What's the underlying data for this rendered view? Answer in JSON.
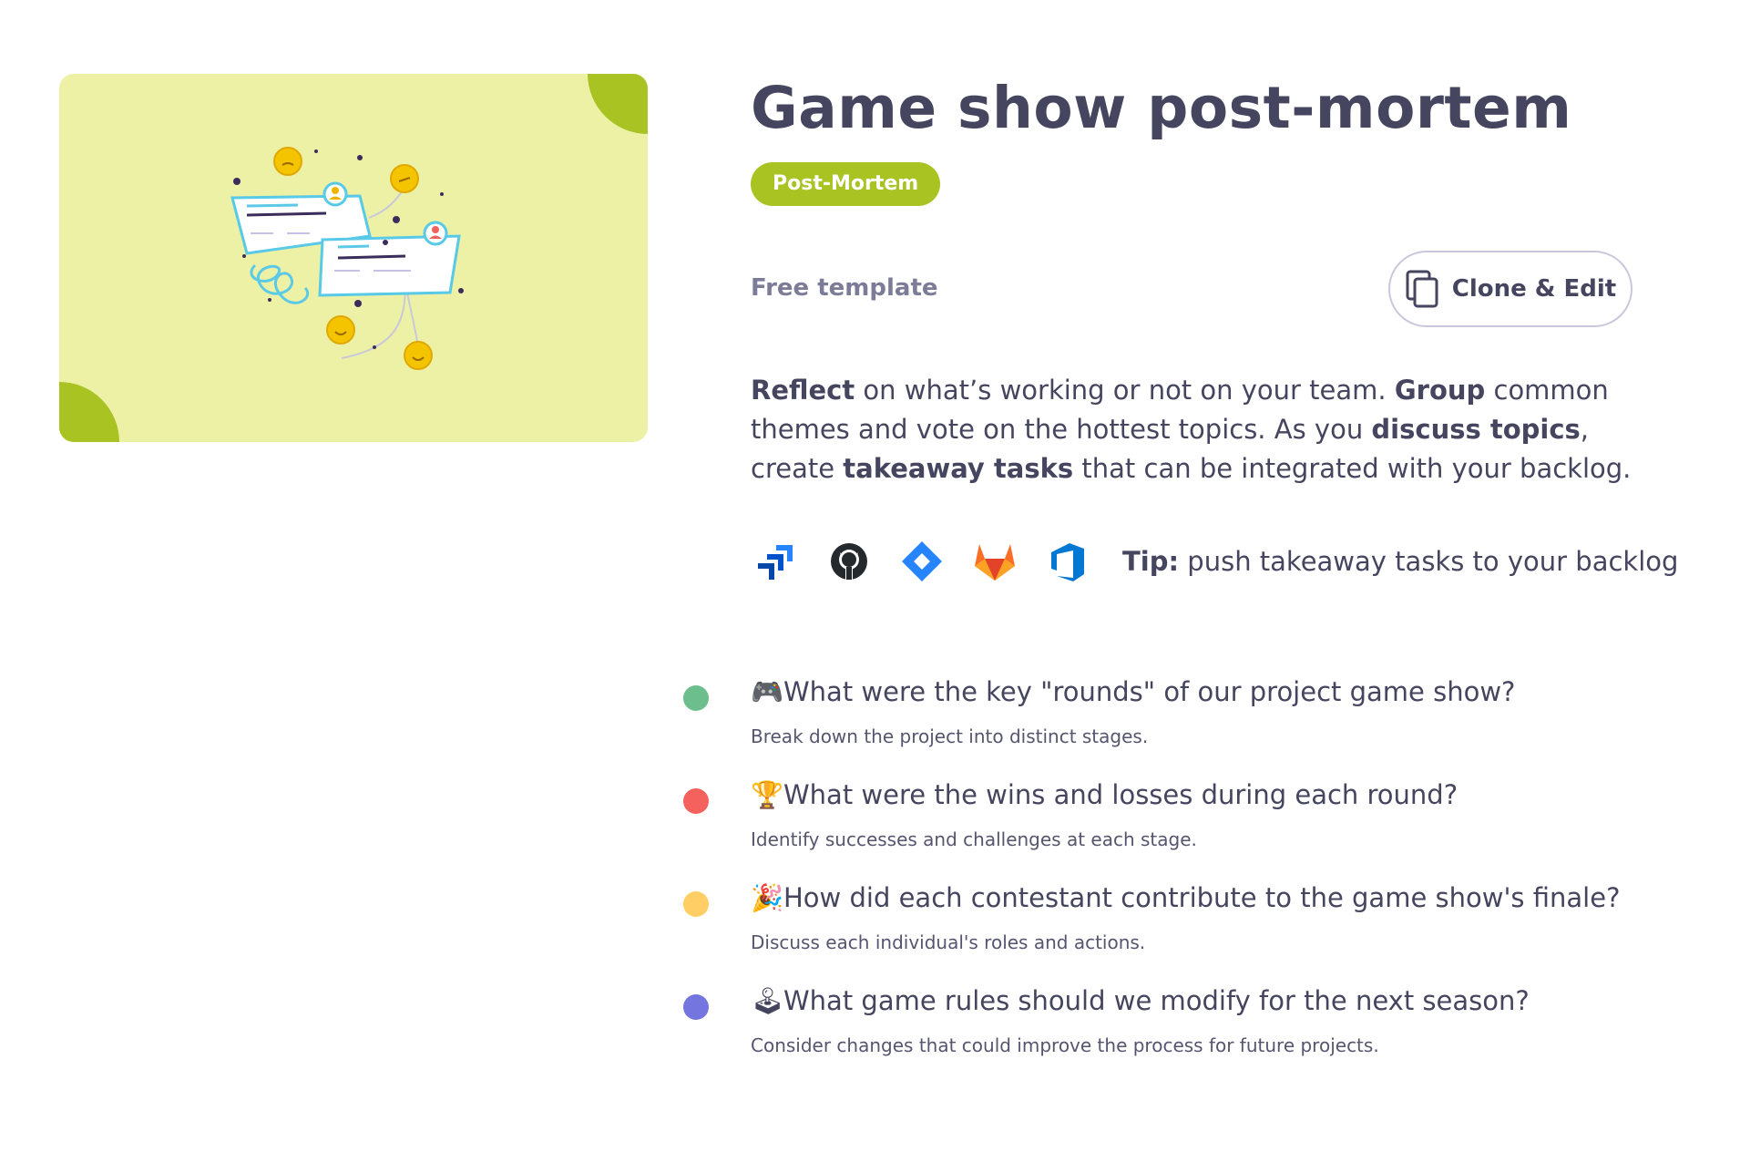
{
  "preview": {
    "image_name": "retrospective-illustration"
  },
  "header": {
    "title": "Game show post-mortem",
    "badge": "Post-Mortem",
    "free_label": "Free template",
    "clone_button": "Clone & Edit"
  },
  "description": {
    "p1_bold": "Reflect",
    "p1_text": " on what’s working or not on your team. ",
    "p2_bold": "Group",
    "p2_text": " common themes and vote on the hottest topics. As you ",
    "p3_bold": "discuss topics",
    "p3_text": ", create ",
    "p4_bold": "takeaway tasks",
    "p4_text": " that can be integrated with your backlog."
  },
  "integrations": {
    "icons": [
      "jira-icon",
      "github-icon",
      "jira-software-icon",
      "gitlab-icon",
      "azure-devops-icon"
    ],
    "tip_bold": "Tip:",
    "tip_text": " push takeaway tasks to your backlog"
  },
  "questions": [
    {
      "color": "#6cbf8d",
      "emoji": "🎮",
      "title": "What were the key \"rounds\" of our project game show?",
      "subtitle": "Break down the project into distinct stages."
    },
    {
      "color": "#f5625d",
      "emoji": "🏆",
      "title": "What were the wins and losses during each round?",
      "subtitle": "Identify successes and challenges at each stage."
    },
    {
      "color": "#ffcf66",
      "emoji": "🎉",
      "title": "How did each contestant contribute to the game show's finale?",
      "subtitle": "Discuss each individual's roles and actions."
    },
    {
      "color": "#7575e0",
      "emoji": "🕹",
      "title": "What game rules should we modify for the next season?",
      "subtitle": "Consider changes that could improve the process for future projects."
    }
  ]
}
